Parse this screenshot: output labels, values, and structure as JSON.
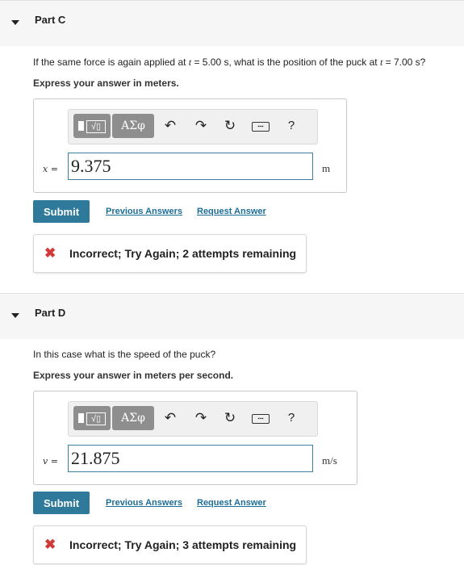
{
  "parts": [
    {
      "title": "Part C",
      "question_prefix": "If the same force is again applied at ",
      "t_var1": "t",
      "question_mid": " = 5.00 s, what is the position of the puck at ",
      "t_var2": "t",
      "question_suffix": " = 7.00 s?",
      "instruction": "Express your answer in meters.",
      "symbols_label": "ΑΣφ",
      "variable_label": "x =",
      "answer_value": "9.375",
      "unit": "m",
      "submit_label": "Submit",
      "previous_answers_label": "Previous Answers",
      "request_answer_label": "Request Answer",
      "feedback": "Incorrect; Try Again; 2 attempts remaining"
    },
    {
      "title": "Part D",
      "question": "In this case what is the speed of the puck?",
      "instruction": "Express your answer in meters per second.",
      "symbols_label": "ΑΣφ",
      "variable_label": "v =",
      "answer_value": "21.875",
      "unit": "m/s",
      "submit_label": "Submit",
      "previous_answers_label": "Previous Answers",
      "request_answer_label": "Request Answer",
      "feedback": "Incorrect; Try Again; 3 attempts remaining"
    }
  ],
  "toolbar_icons": [
    "templates-icon",
    "symbols-icon",
    "undo-icon",
    "redo-icon",
    "reset-icon",
    "keyboard-icon",
    "help-icon"
  ],
  "colors": {
    "submit": "#2f7a9a",
    "link": "#1d6d96",
    "error": "#d23a3a",
    "input_border": "#3f7fa0"
  }
}
